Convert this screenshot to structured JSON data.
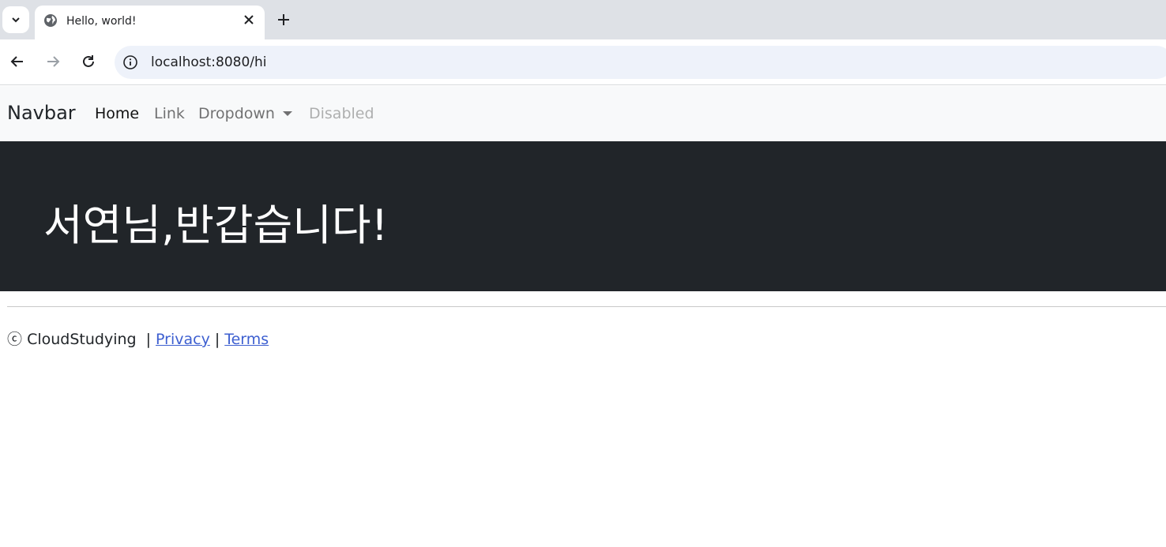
{
  "browser": {
    "tab_title": "Hello, world!",
    "url": "localhost:8080/hi"
  },
  "navbar": {
    "brand": "Navbar",
    "links": [
      {
        "label": "Home"
      },
      {
        "label": "Link"
      },
      {
        "label": "Dropdown"
      },
      {
        "label": "Disabled"
      }
    ]
  },
  "hero": {
    "title": "서연님,반갑습니다!"
  },
  "footer": {
    "copyright_symbol": "ⓒ",
    "company": "CloudStudying",
    "separator": "|",
    "privacy": "Privacy",
    "terms": "Terms"
  },
  "colors": {
    "hero_bg": "#212529",
    "navbar_bg": "#f8f9fa",
    "link": "#3d5fd0"
  }
}
